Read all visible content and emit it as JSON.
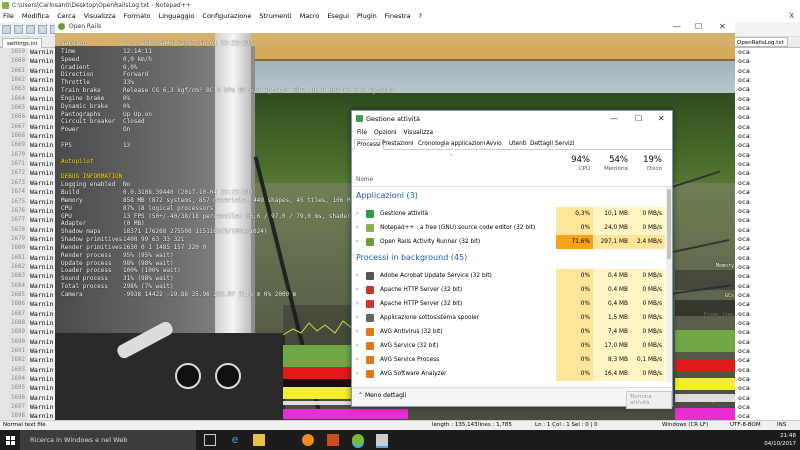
{
  "npp": {
    "title": "C:\\Users\\Carlosanti\\Desktop\\OpenRailsLog.txt - Notepad++",
    "menu": [
      "File",
      "Modifica",
      "Cerca",
      "Visualizza",
      "Formato",
      "Linguaggio",
      "Configurazione",
      "Strumenti",
      "Macro",
      "Esegui",
      "Plugin",
      "Finestra",
      "?"
    ],
    "tab_left": "settings.ini",
    "tab_right": "OpenRailsLog.txt",
    "close": "X",
    "line_start": 1659,
    "line_end": 1698,
    "warn_word": "Warnin",
    "right_word": "oca",
    "status": {
      "type": "Normal text file",
      "length": "length : 135,143",
      "lines": "lines : 1,785",
      "pos": "Ln : 1    Col : 1    Sel : 0 | 0",
      "eol": "Windows (CR LF)",
      "enc": "UTF-8-BOM",
      "ins": "INS"
    }
  },
  "openrails": {
    "title": "Open Rails",
    "controls": {
      "min": "—",
      "max": "☐",
      "close": "✕"
    },
    "hud": [
      {
        "k": "Version",
        "v": "1.0.3108.39440 (2017-10-04 23:23:29)"
      },
      {
        "k": "Time",
        "v": "12:14:11"
      },
      {
        "k": "Speed",
        "v": "0,0 km/h"
      },
      {
        "k": "Gradient",
        "v": "0,0%"
      },
      {
        "k": "Direction",
        "v": "Forward"
      },
      {
        "k": "Throttle",
        "v": "33%"
      },
      {
        "k": "Train brake",
        "v": "Release CG 6,3 kgf/cm² BC 0 kPa BP 6,0 kgf/cm² EOT, BC 0 kPa BP 6,3 kgf/cm²"
      },
      {
        "k": "Engine brake",
        "v": "0%"
      },
      {
        "k": "Dynamic brake",
        "v": "0%"
      },
      {
        "k": "Pantographs",
        "v": "Up Up.on"
      },
      {
        "k": "Circuit breaker",
        "v": "Closed"
      },
      {
        "k": "Power",
        "v": "On"
      },
      {
        "k": "",
        "v": ""
      },
      {
        "k": "FPS",
        "v": "13"
      },
      {
        "k": "",
        "v": ""
      },
      {
        "k": "Autopilot",
        "v": "",
        "head": true
      },
      {
        "k": "",
        "v": ""
      },
      {
        "k": "DEBUG INFORMATION",
        "v": "",
        "head": true
      },
      {
        "k": "Logging enabled",
        "v": "No"
      },
      {
        "k": "Build",
        "v": "0.0.3108.39440 (2017-10-04 23:23:29)"
      },
      {
        "k": "Memory",
        "v": "858 MB (872 systems, 857 materials, 449 shapes, 45 tiles, 106 MB managed, 77 ..."
      },
      {
        "k": "CPU",
        "v": "87% (8 logical processors)"
      },
      {
        "k": "GPU",
        "v": "13 FPS (50+/-40/38/18 percentile) 66,6 / 97,0 / 79,0 ms, shader model 3"
      },
      {
        "k": "Adapter",
        "v": "(0 MB)"
      },
      {
        "k": "Shadow maps",
        "v": "18371    176268    275508    1151165(5/1024/1024)"
      },
      {
        "k": "Shadow primitives",
        "v": "1408     99        63        33        321"
      },
      {
        "k": "Render primitives",
        "v": "1630     0         1         1485      157       320      0"
      },
      {
        "k": "Render process",
        "v": "95% (95% wait)"
      },
      {
        "k": "Update process",
        "v": "98% (98% wait)"
      },
      {
        "k": "Loader process",
        "v": "100% (100% wait)"
      },
      {
        "k": "Sound process",
        "v": "31% (98% wait)"
      },
      {
        "k": "Total process",
        "v": "298% (7% wait)"
      },
      {
        "k": "Camera",
        "v": "-9938    14422    -19.88    35.96    263.97    31.6 m    0%    2000 m"
      }
    ],
    "graph_labels": [
      "Memory",
      "GCs",
      "Frame time",
      "Render process",
      "Updater process",
      "Loader process",
      "Sound process"
    ]
  },
  "taskmgr": {
    "title": "Gestione attività",
    "controls": {
      "min": "—",
      "max": "☐",
      "close": "✕"
    },
    "menu": [
      "File",
      "Opzioni",
      "Visualizza"
    ],
    "tabs": [
      "Processi",
      "Prestazioni",
      "Cronologia applicazioni",
      "Avvio",
      "Utenti",
      "Dettagli",
      "Servizi"
    ],
    "headers": {
      "name": "Nome",
      "cpu_pct": "94%",
      "cpu_lbl": "CPU",
      "mem_pct": "54%",
      "mem_lbl": "Memoria",
      "disk_pct": "19%",
      "disk_lbl": "Disco"
    },
    "group_apps": "Applicazioni (3)",
    "group_bg": "Processi in background (45)",
    "apps": [
      {
        "name": "Gestione attività",
        "cpu": "0,3%",
        "mem": "10,1 MB",
        "disk": "0 MB/s",
        "icon": "taskmgr-icon",
        "color": "#2e9c4c"
      },
      {
        "name": "Notepad++ : a free (GNU) source code editor (32 bit)",
        "cpu": "0%",
        "mem": "24,0 MB",
        "disk": "0 MB/s",
        "icon": "notepadpp-icon",
        "color": "#8ab04a"
      },
      {
        "name": "Open Rails Activity Runner (32 bit)",
        "cpu": "71,6%",
        "mem": "297,1 MB",
        "disk": "2,4 MB/s",
        "icon": "openrails-icon",
        "color": "#6b9e3a",
        "hot": true
      }
    ],
    "bg": [
      {
        "name": "Adobe Acrobat Update Service (32 bit)",
        "cpu": "0%",
        "mem": "0,4 MB",
        "disk": "0 MB/s",
        "icon": "service-icon",
        "color": "#555"
      },
      {
        "name": "Apache HTTP Server (32 bit)",
        "cpu": "0%",
        "mem": "0,4 MB",
        "disk": "0 MB/s",
        "icon": "apache-icon",
        "color": "#c8352a"
      },
      {
        "name": "Apache HTTP Server (32 bit)",
        "cpu": "0%",
        "mem": "0,4 MB",
        "disk": "0 MB/s",
        "icon": "apache-icon",
        "color": "#c8352a"
      },
      {
        "name": "Applicazione sottosistema spooler",
        "cpu": "0%",
        "mem": "1,5 MB",
        "disk": "0 MB/s",
        "icon": "printer-icon",
        "color": "#666"
      },
      {
        "name": "AVG Antivirus (32 bit)",
        "cpu": "0%",
        "mem": "7,4 MB",
        "disk": "0 MB/s",
        "icon": "avg-icon",
        "color": "#e07b1a"
      },
      {
        "name": "AVG Service (32 bit)",
        "cpu": "0%",
        "mem": "17,0 MB",
        "disk": "0 MB/s",
        "icon": "avg-icon",
        "color": "#e07b1a"
      },
      {
        "name": "AVG Service Process",
        "cpu": "0%",
        "mem": "8,3 MB",
        "disk": "0,1 MB/s",
        "icon": "avg-icon",
        "color": "#e07b1a"
      },
      {
        "name": "AVG Software Analyzer",
        "cpu": "0%",
        "mem": "16,4 MB",
        "disk": "0 MB/s",
        "icon": "avg-icon",
        "color": "#e07b1a"
      }
    ],
    "less_details": "Meno dettagli",
    "end_task": "Termina attività"
  },
  "taskbar": {
    "search": "Ricerca in Windows e nel Web",
    "time": "21:48",
    "date": "04/10/2017"
  }
}
